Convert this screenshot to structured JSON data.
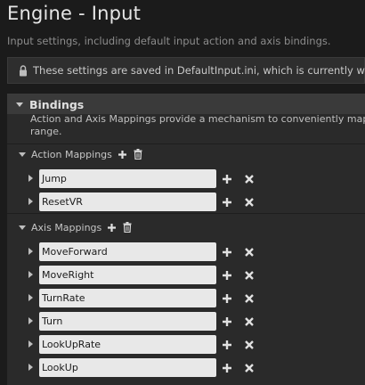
{
  "header": {
    "title": "Engine - Input",
    "subtitle": "Input settings, including default input action and axis bindings."
  },
  "notice": {
    "text": "These settings are saved in DefaultInput.ini, which is currently writable."
  },
  "bindings": {
    "title": "Bindings",
    "description_line1": "Action and Axis Mappings provide a mechanism to conveniently map keys",
    "description_line2": "range.",
    "action_mappings": {
      "label": "Action Mappings",
      "items": [
        "Jump",
        "ResetVR"
      ]
    },
    "axis_mappings": {
      "label": "Axis Mappings",
      "items": [
        "MoveForward",
        "MoveRight",
        "TurnRate",
        "Turn",
        "LookUpRate",
        "LookUp"
      ]
    }
  },
  "icons": {
    "lock": "lock-icon",
    "add": "plus-icon",
    "remove_all": "trash-icon",
    "remove": "x-icon"
  }
}
